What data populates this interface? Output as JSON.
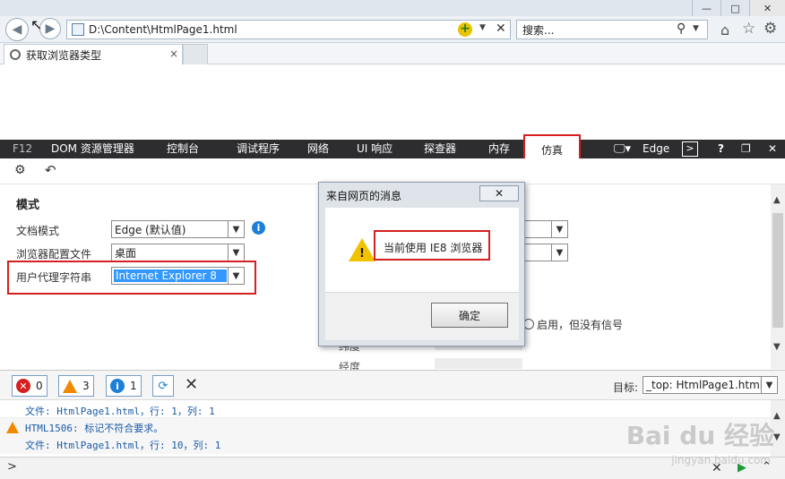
{
  "browser": {
    "address": "D:\\Content\\HtmlPage1.html",
    "search_placeholder": "搜索...",
    "tab_title": "获取浏览器类型"
  },
  "devtools": {
    "f12_label": "F12",
    "tabs": [
      "DOM 资源管理器",
      "控制台",
      "调试程序",
      "网络",
      "UI 响应",
      "探查器",
      "内存",
      "仿真"
    ],
    "mode_label": "Edge",
    "emulation": {
      "section_title": "模式",
      "doc_mode_label": "文档模式",
      "doc_mode_value": "Edge (默认值)",
      "browser_profile_label": "浏览器配置文件",
      "browser_profile_value": "桌面",
      "ua_label": "用户代理字符串",
      "ua_value": "Internet Explorer 8",
      "geo_option": "启用，但没有信号",
      "latitude_label": "纬度",
      "longitude_label": "经度"
    },
    "console": {
      "errors": "0",
      "warnings": "3",
      "infos": "1",
      "target_label": "目标:",
      "target_value": "_top: HtmlPage1.html",
      "lines": [
        "文件: HtmlPage1.html，行: 1，列: 1",
        "HTML1506: 标记不符合要求。",
        "文件: HtmlPage1.html，行: 10，列: 1"
      ]
    }
  },
  "dialog": {
    "title": "来自网页的消息",
    "message": "当前使用 IE8 浏览器",
    "ok_label": "确定"
  },
  "watermark": {
    "logo": "Bai du 经验",
    "url": "jingyan.baidu.com"
  },
  "colors": {
    "accent_red": "#d42020",
    "f12_bar": "#2d2d30",
    "selection_blue": "#3399ff"
  }
}
